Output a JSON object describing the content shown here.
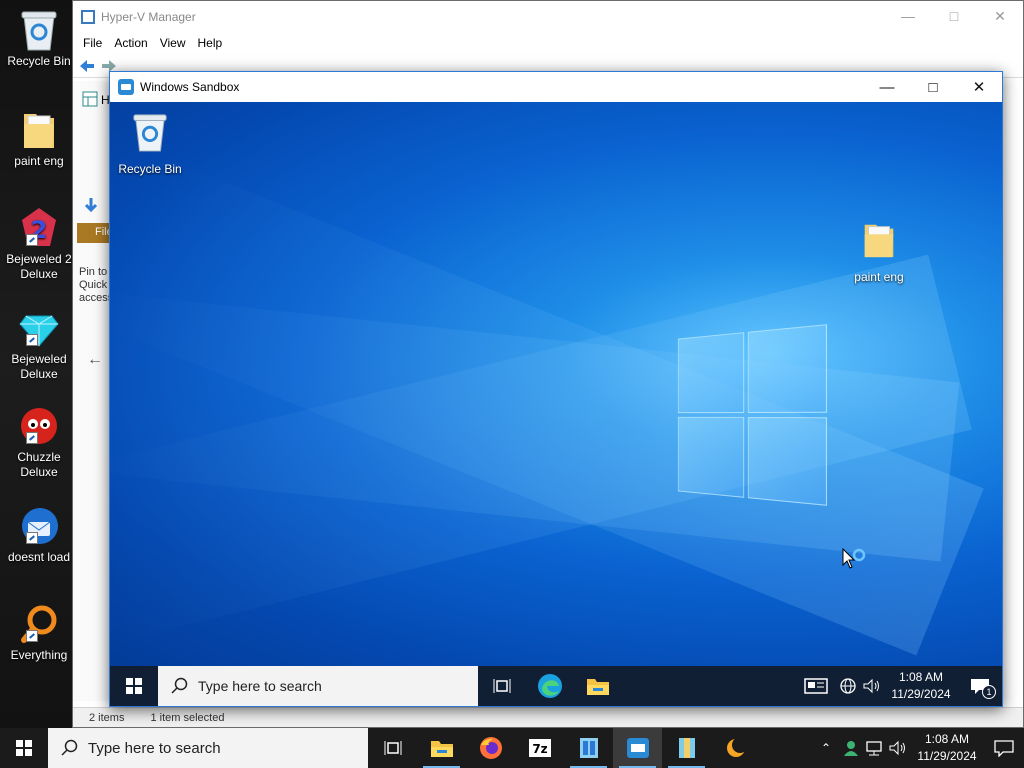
{
  "host": {
    "desktop_icons": [
      {
        "label": "Recycle Bin",
        "icon": "recycle-bin-icon"
      },
      {
        "label": "paint eng",
        "icon": "folder-icon"
      },
      {
        "label": "Bejeweled 2 Deluxe",
        "icon": "bejeweled2-icon"
      },
      {
        "label": "Bejeweled Deluxe",
        "icon": "bejeweled-icon"
      },
      {
        "label": "Chuzzle Deluxe",
        "icon": "chuzzle-icon"
      },
      {
        "label": "doesnt load",
        "icon": "thunderbird-icon"
      },
      {
        "label": "Everything",
        "icon": "everything-icon"
      }
    ],
    "taskbar": {
      "search_placeholder": "Type here to search",
      "apps": [
        "task-view-icon",
        "file-explorer-icon",
        "firefox-icon",
        "7zip-icon",
        "hyperv-manager-icon",
        "windows-sandbox-icon",
        "archive-icon",
        "moon-icon"
      ],
      "time": "1:08 AM",
      "date": "11/29/2024"
    }
  },
  "hyperv": {
    "title": "Hyper-V Manager",
    "menu": [
      "File",
      "Action",
      "View",
      "Help"
    ],
    "tree_label": "Hy",
    "ribbon_tab": "File",
    "pin_text": "Pin to Quick access",
    "status_items": "2 items",
    "status_selected": "1 item selected"
  },
  "sandbox": {
    "title": "Windows Sandbox",
    "desktop_icons": [
      {
        "label": "Recycle Bin",
        "icon": "recycle-bin-icon"
      },
      {
        "label": "paint eng",
        "icon": "folder-icon"
      }
    ],
    "taskbar": {
      "search_placeholder": "Type here to search",
      "time": "1:08 AM",
      "date": "11/29/2024",
      "notification_count": "1"
    }
  },
  "colors": {
    "sandbox_accent": "#2b78d6",
    "sandbox_taskbar": "#101f33",
    "host_taskbar": "#1b1b1b",
    "ribbon_file": "#a97924"
  }
}
